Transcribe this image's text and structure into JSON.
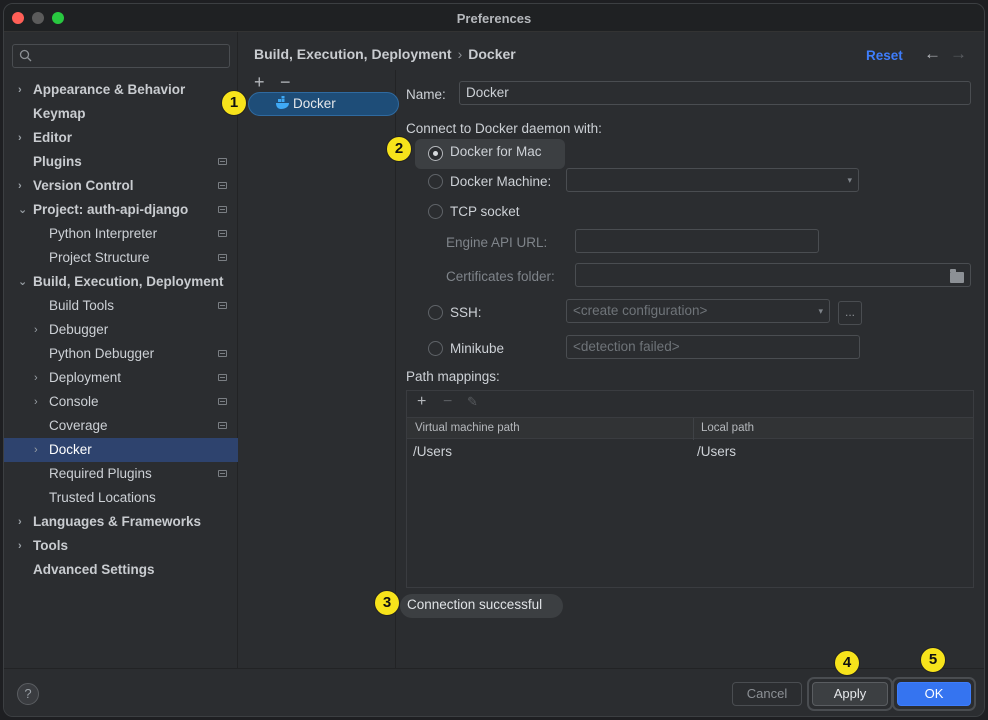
{
  "window": {
    "title": "Preferences"
  },
  "sidebar": {
    "search_placeholder": "",
    "items": [
      {
        "label": "Appearance & Behavior",
        "chevron": "›"
      },
      {
        "label": "Keymap"
      },
      {
        "label": "Editor",
        "chevron": "›"
      },
      {
        "label": "Plugins"
      },
      {
        "label": "Version Control",
        "chevron": "›"
      },
      {
        "label": "Project: auth-api-django",
        "chevron": "⌄"
      },
      {
        "label": "Python Interpreter"
      },
      {
        "label": "Project Structure"
      },
      {
        "label": "Build, Execution, Deployment",
        "chevron": "⌄"
      },
      {
        "label": "Build Tools"
      },
      {
        "label": "Debugger",
        "chevron": "›"
      },
      {
        "label": "Python Debugger"
      },
      {
        "label": "Deployment",
        "chevron": "›"
      },
      {
        "label": "Console",
        "chevron": "›"
      },
      {
        "label": "Coverage"
      },
      {
        "label": "Docker",
        "chevron": "›"
      },
      {
        "label": "Required Plugins"
      },
      {
        "label": "Trusted Locations"
      },
      {
        "label": "Languages & Frameworks",
        "chevron": "›"
      },
      {
        "label": "Tools",
        "chevron": "›"
      },
      {
        "label": "Advanced Settings"
      }
    ]
  },
  "header": {
    "crumb_parent": "Build, Execution, Deployment",
    "crumb_sep": "›",
    "crumb_current": "Docker",
    "reset_label": "Reset",
    "back_icon": "←",
    "forward_icon": "→"
  },
  "list": {
    "add_icon": "+",
    "remove_icon": "−",
    "docker_item_label": "Docker"
  },
  "form": {
    "name_label": "Name:",
    "name_value": "Docker",
    "connect_label": "Connect to Docker daemon with:",
    "opt_docker_mac": "Docker for Mac",
    "opt_docker_machine": "Docker Machine:",
    "opt_tcp": "TCP socket",
    "engine_api_label": "Engine API URL:",
    "certs_label": "Certificates folder:",
    "opt_ssh": "SSH:",
    "ssh_placeholder": "<create configuration>",
    "ssh_more": "...",
    "opt_minikube": "Minikube",
    "minikube_placeholder": "<detection failed>",
    "dropdown_icon": "▾"
  },
  "mappings": {
    "title": "Path mappings:",
    "add_icon": "+",
    "remove_icon": "−",
    "edit_icon": "✎",
    "col_vm": "Virtual machine path",
    "col_local": "Local path",
    "rows": [
      {
        "vm": "/Users",
        "local": "/Users"
      }
    ]
  },
  "status": {
    "text": "Connection successful"
  },
  "buttons": {
    "help": "?",
    "cancel": "Cancel",
    "apply": "Apply",
    "ok": "OK"
  },
  "markers": [
    "1",
    "2",
    "3",
    "4",
    "5"
  ],
  "colors": {
    "accent_blue": "#3574f0",
    "link_blue": "#3e7dfc",
    "selection": "#2e436e",
    "marker_yellow": "#f7e31b"
  }
}
